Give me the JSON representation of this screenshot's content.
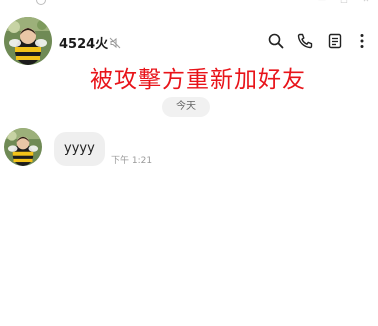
{
  "window": {
    "controls": {
      "minimize_icon": "minimize-icon",
      "maximize_icon": "maximize-icon",
      "close_icon": "close-icon"
    }
  },
  "header": {
    "contact_name": "4524火",
    "muted": true,
    "icons": [
      "search-icon",
      "phone-icon",
      "notes-icon",
      "more-vertical-icon"
    ]
  },
  "overlay": {
    "caption": "被攻擊方重新加好友",
    "color": "#e8141a"
  },
  "conversation": {
    "date_divider": "今天",
    "messages": [
      {
        "sender": "contact",
        "text": "yyyy",
        "time": "下午 1:21"
      }
    ]
  }
}
